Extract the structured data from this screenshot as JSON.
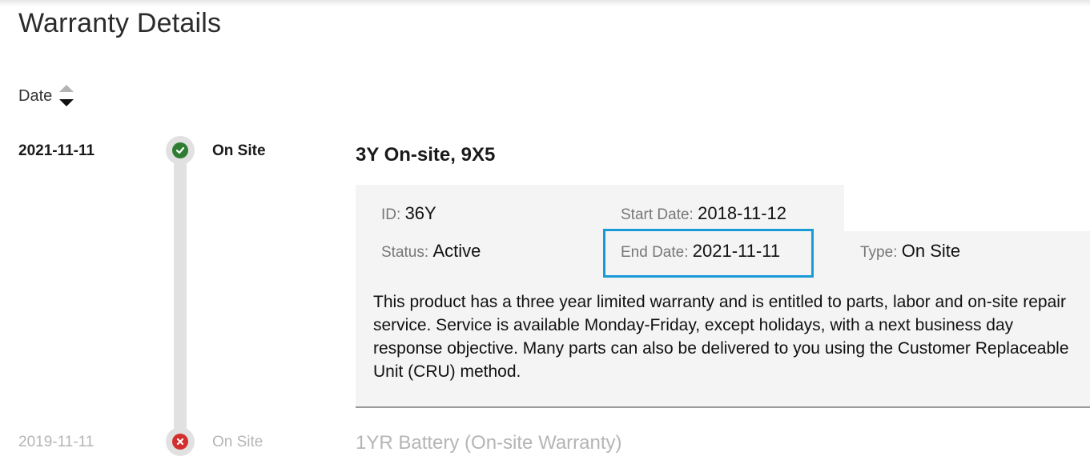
{
  "page": {
    "title": "Warranty Details"
  },
  "sort": {
    "label": "Date"
  },
  "entries": [
    {
      "date": "2021-11-11",
      "type": "On Site",
      "title": "3Y On-site, 9X5",
      "status_icon": "check-icon",
      "status_color": "#2e7d32",
      "details": {
        "id_label": "ID",
        "id_value": "36Y",
        "start_label": "Start Date",
        "start_value": "2018-11-12",
        "status_label": "Status",
        "status_value": "Active",
        "end_label": "End Date",
        "end_value": "2021-11-11",
        "type_label": "Type",
        "type_value": "On Site"
      },
      "description": "This product has a three year limited warranty and is entitled to parts, labor and on-site repair service. Service is available Monday-Friday, except holidays, with a next business day response objective. Many parts can also be delivered to you using the Customer Replaceable Unit (CRU) method."
    },
    {
      "date": "2019-11-11",
      "type": "On Site",
      "title": "1YR Battery (On-site Warranty)",
      "status_icon": "x-icon",
      "status_color": "#d32f2f"
    }
  ],
  "colors": {
    "highlight": "#1a9bd7",
    "panel_bg": "#f4f4f4",
    "timeline": "#e1e1e1"
  }
}
